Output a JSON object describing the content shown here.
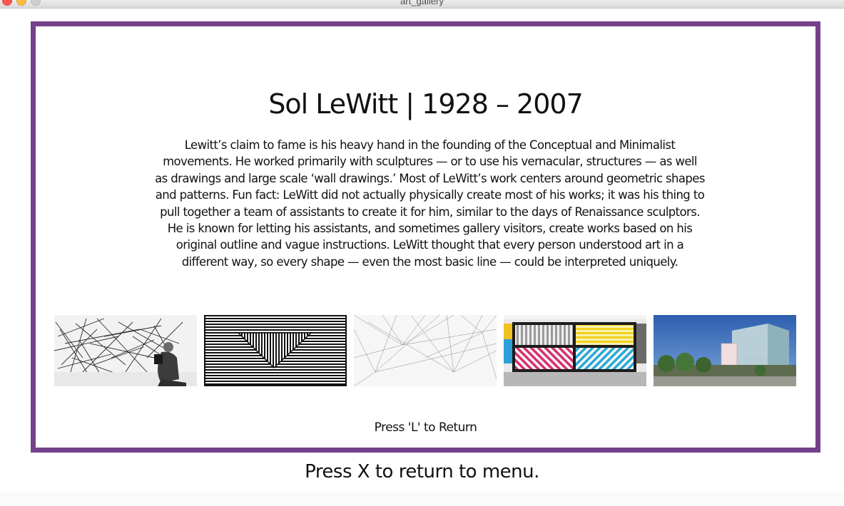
{
  "window": {
    "title": "art_gallery",
    "traffic_lights": [
      "close",
      "minimize",
      "maximize"
    ]
  },
  "panel": {
    "frame_color": "#74418a",
    "title": "Sol LeWitt | 1928 – 2007",
    "bio_lines": [
      "Lewitt’s claim to fame is his heavy hand in the founding of the Conceptual and Minimalist",
      "movements. He worked primarily with sculptures — or to use his vernacular, structures — as well",
      "as drawings and large scale ‘wall drawings.’ Most of LeWitt’s work centers around geometric shapes",
      "and patterns. Fun fact: LeWitt did not actually physically create most of his works; it was his thing to",
      "pull together a team of assistants to create it for him, similar to the days of Renaissance sculptors.",
      "He is known for letting his assistants, and sometimes gallery visitors, create works based on his",
      "original outline and vague instructions. LeWitt thought that every person understood art in a",
      "different way, so every shape — even the most basic line — could be interpreted uniquely."
    ],
    "thumbnails": [
      {
        "name": "scribble-wall-drawing-thumbnail"
      },
      {
        "name": "striped-triangle-thumbnail"
      },
      {
        "name": "radiating-lines-thumbnail"
      },
      {
        "name": "colored-stripes-wall-thumbnail"
      },
      {
        "name": "museum-building-thumbnail"
      }
    ],
    "return_hint": "Press 'L' to Return"
  },
  "footer": {
    "hint": "Press X to return to menu."
  }
}
